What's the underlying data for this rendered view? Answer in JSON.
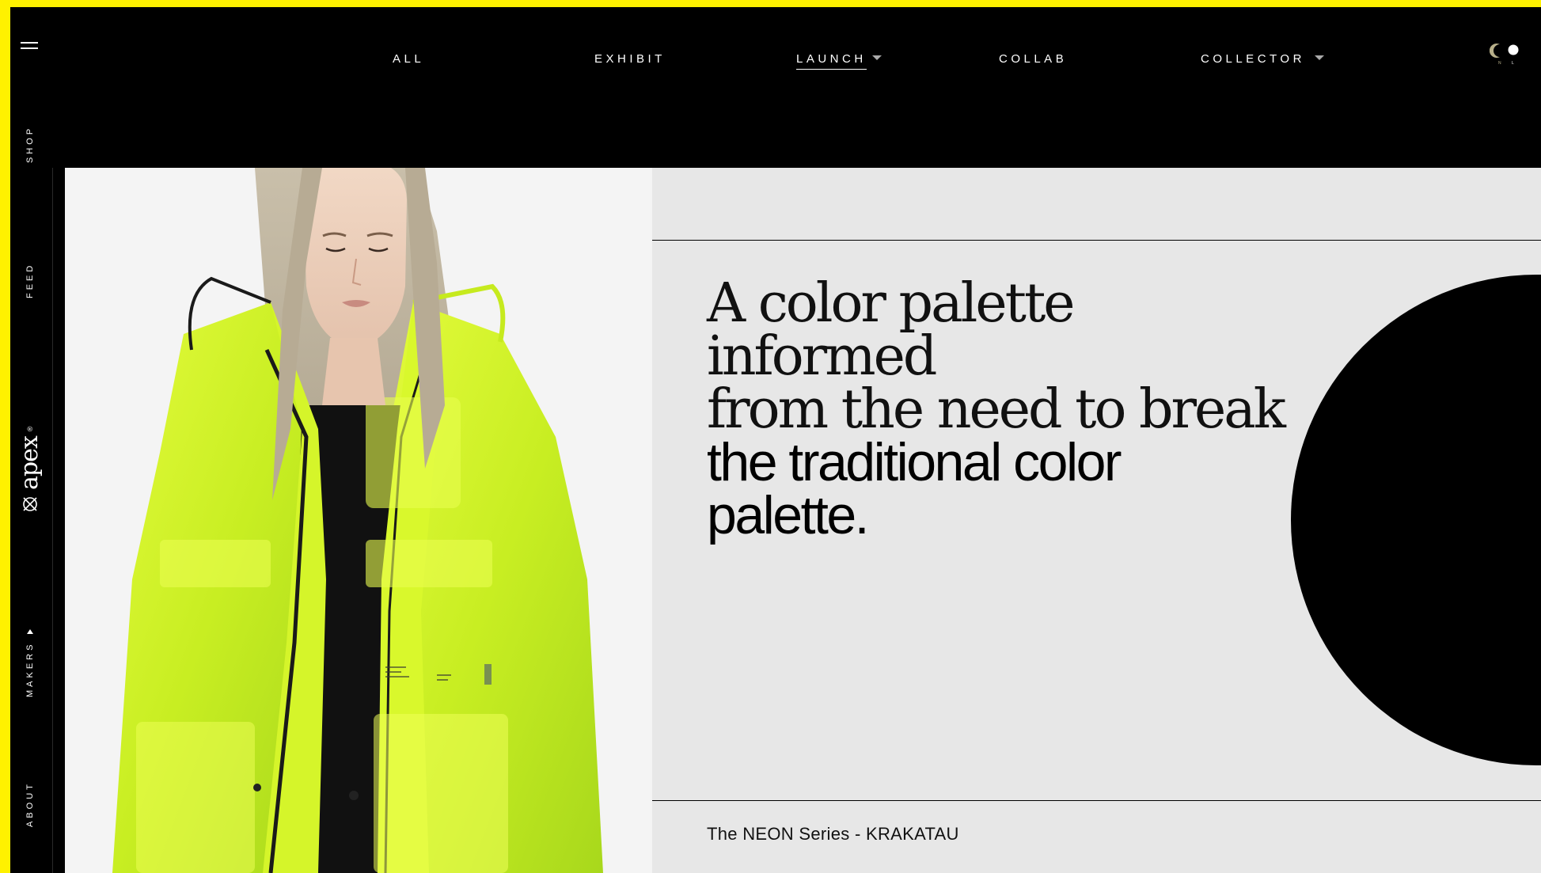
{
  "brand": {
    "logo_text": "apex",
    "trademark": "®"
  },
  "colors": {
    "frame": "#fff100",
    "background": "#000000",
    "content_panel": "#e7e7e7",
    "photo_panel": "#f4f4f4",
    "jacket": "#d2f51c"
  },
  "sidebar": {
    "links": [
      {
        "label": "SHOP"
      },
      {
        "label": "FEED"
      },
      {
        "label": "MAKERS"
      },
      {
        "label": "ABOUT"
      }
    ]
  },
  "nav": {
    "items": [
      {
        "label": "ALL"
      },
      {
        "label": "EXHIBIT"
      },
      {
        "label": "LAUNCH",
        "active": true
      },
      {
        "label": "COLLAB"
      },
      {
        "label": "COLLECTOR"
      }
    ],
    "theme_toggle": {
      "icons": [
        "moon-icon",
        "sun-icon"
      ],
      "moon_label": "N",
      "sun_label": "L"
    }
  },
  "hero": {
    "image": "woman-in-neon-yellow-raincoat",
    "headline_light": [
      "A color palette informed",
      "from the need to break"
    ],
    "headline_bold": [
      "the traditional color",
      "palette."
    ],
    "caption": "The NEON Series - KRAKATAU"
  }
}
